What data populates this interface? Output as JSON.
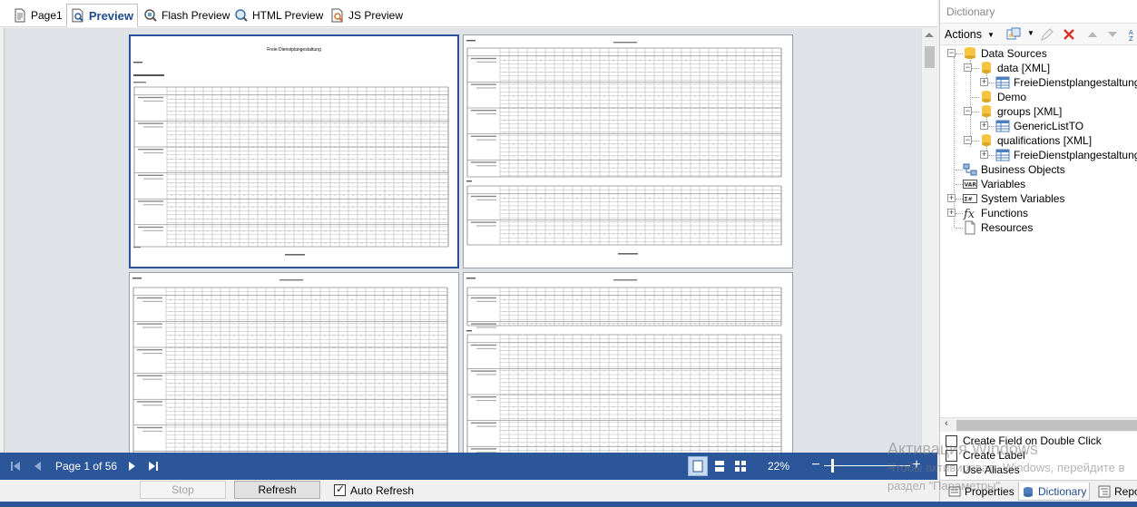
{
  "tabs": [
    {
      "label": "Page1",
      "icon": "page-icon"
    },
    {
      "label": "Preview",
      "icon": "preview-icon",
      "active": true
    },
    {
      "label": "Flash Preview",
      "icon": "flash-preview-icon"
    },
    {
      "label": "HTML Preview",
      "icon": "html-preview-icon"
    },
    {
      "label": "JS Preview",
      "icon": "js-preview-icon"
    }
  ],
  "preview": {
    "pages": [
      {
        "title": "Freie Dienstplangestaltung",
        "selected": true
      },
      {
        "title": ""
      },
      {
        "title": ""
      },
      {
        "title": ""
      }
    ]
  },
  "navigation": {
    "page_info": "Page 1 of 56",
    "zoom": "22%",
    "zoom_minus": "−",
    "zoom_plus": "+"
  },
  "toolbar": {
    "stop_label": "Stop",
    "refresh_label": "Refresh",
    "auto_refresh_label": "Auto Refresh",
    "auto_refresh_checked": true
  },
  "dictionary": {
    "header": "Dictionary",
    "actions_label": "Actions",
    "tree": [
      {
        "label": "Data Sources",
        "icon": "data-sources-icon",
        "level": 0,
        "expander": "−"
      },
      {
        "label": "data [XML]",
        "icon": "database-icon",
        "level": 1,
        "expander": "−"
      },
      {
        "label": "FreieDienstplangestaltungTO",
        "icon": "table-icon",
        "level": 2,
        "expander": "+"
      },
      {
        "label": "Demo",
        "icon": "database-icon",
        "level": 1,
        "expander": ""
      },
      {
        "label": "groups [XML]",
        "icon": "database-icon",
        "level": 1,
        "expander": "−"
      },
      {
        "label": "GenericListTO",
        "icon": "table-icon",
        "level": 2,
        "expander": "+"
      },
      {
        "label": "qualifications [XML]",
        "icon": "database-icon",
        "level": 1,
        "expander": "−"
      },
      {
        "label": "FreieDienstplangestaltungQu",
        "icon": "table-icon",
        "level": 2,
        "expander": "+"
      },
      {
        "label": "Business Objects",
        "icon": "business-objects-icon",
        "level": 0,
        "expander": ""
      },
      {
        "label": "Variables",
        "icon": "variables-icon",
        "level": 0,
        "expander": ""
      },
      {
        "label": "System Variables",
        "icon": "system-variables-icon",
        "level": 0,
        "expander": "+"
      },
      {
        "label": "Functions",
        "icon": "functions-icon",
        "level": 0,
        "expander": "+"
      },
      {
        "label": "Resources",
        "icon": "resources-icon",
        "level": 0,
        "expander": ""
      }
    ],
    "options": [
      {
        "label": "Create Field on Double Click",
        "checked": false
      },
      {
        "label": "Create Label",
        "checked": false
      },
      {
        "label": "Use Aliases",
        "checked": false
      }
    ],
    "tabs": [
      {
        "label": "Properties"
      },
      {
        "label": "Dictionary",
        "active": true
      },
      {
        "label": "Repo"
      }
    ]
  },
  "watermark": {
    "line1": "Активация Windows",
    "line2": "Чтобы активировать Windows, перейдите в",
    "line3": "раздел \"Параметры\"."
  },
  "colors": {
    "accent": "#2b579a",
    "selected_page_border": "#2a5298",
    "preview_bg": "#dfe2e7"
  }
}
